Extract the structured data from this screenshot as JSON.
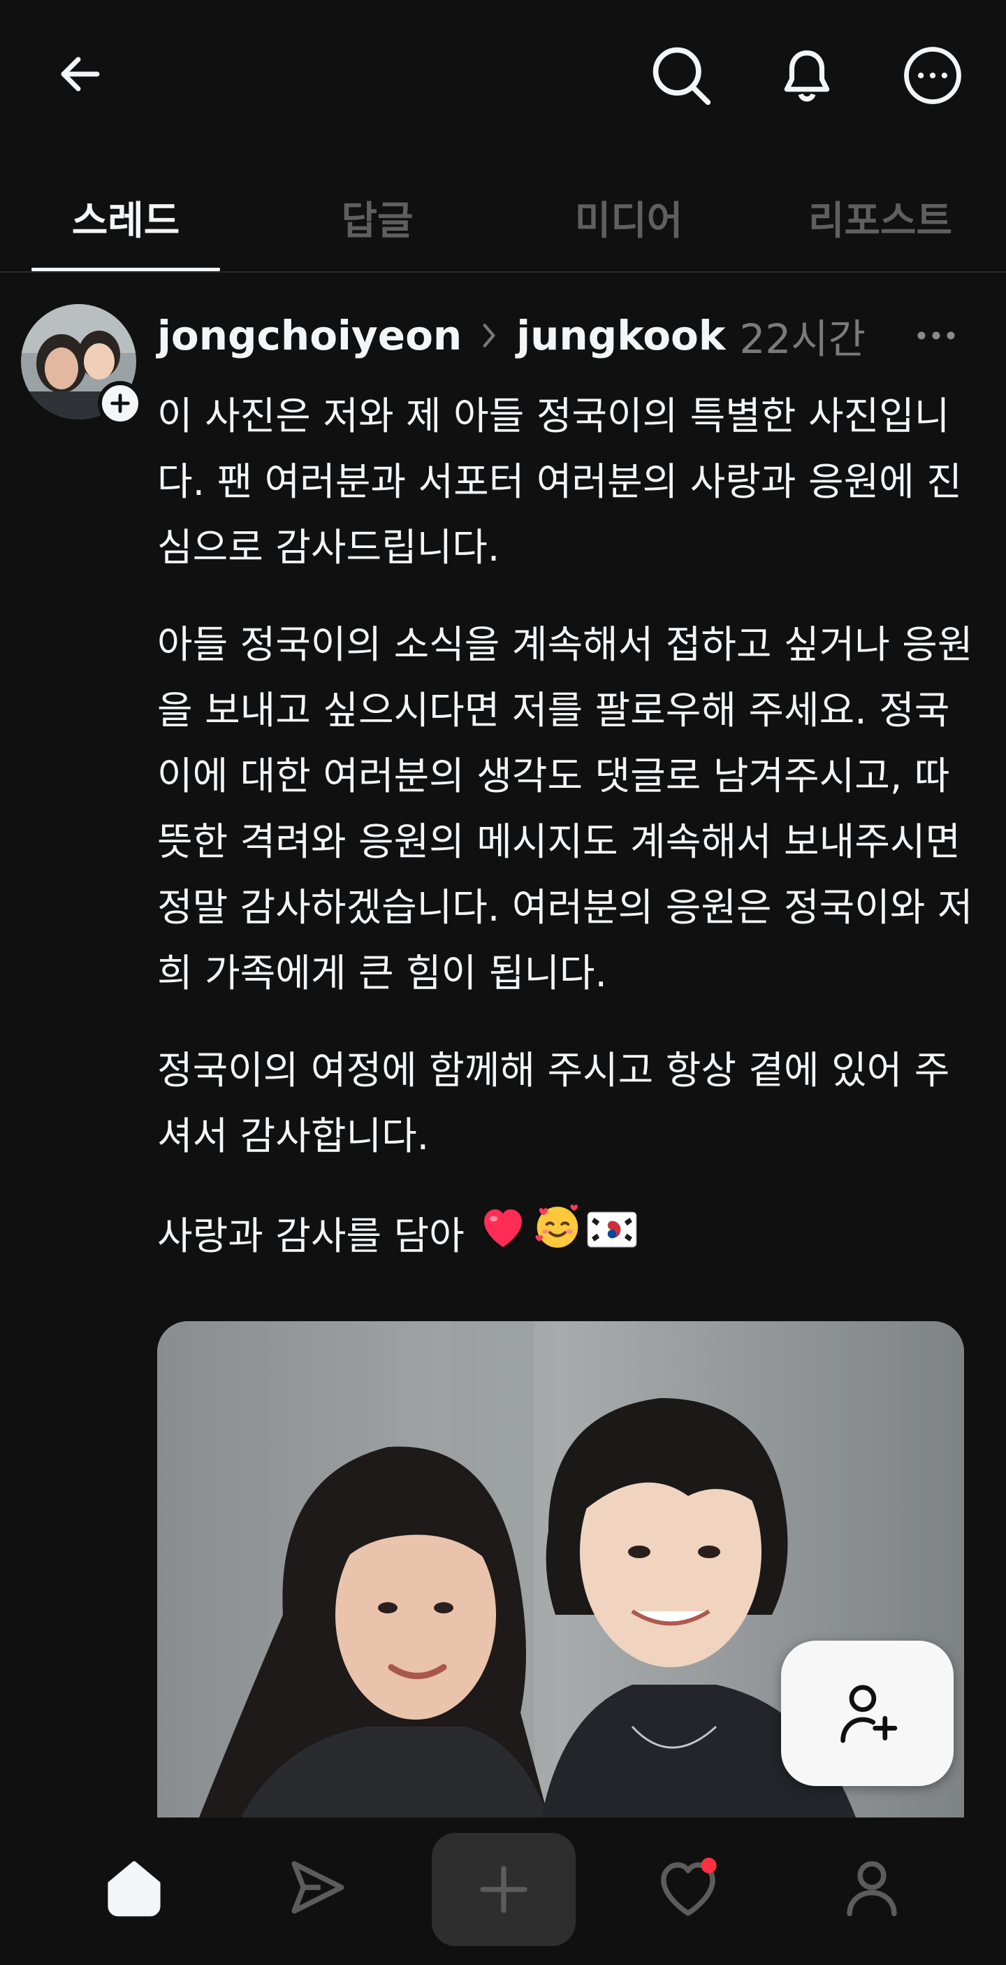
{
  "tabs": [
    {
      "label": "스레드"
    },
    {
      "label": "답글"
    },
    {
      "label": "미디어"
    },
    {
      "label": "리포스트"
    }
  ],
  "post": {
    "author": "jongchoiyeon",
    "reply_to": "jungkook",
    "time": "22시간",
    "paragraphs": [
      "이 사진은 저와 제 아들 정국이의 특별한 사진입니다. 팬 여러분과 서포터 여러분의 사랑과 응원에 진심으로 감사드립니다.",
      "아들 정국이의 소식을 계속해서 접하고 싶거나 응원을 보내고 싶으시다면 저를 팔로우해 주세요. 정국이에 대한 여러분의 생각도 댓글로 남겨주시고, 따뜻한 격려와 응원의 메시지도 계속해서 보내주시면 정말 감사하겠습니다. 여러분의 응원은 정국이와 저희 가족에게 큰 힘이 됩니다.",
      "정국이의 여정에 함께해 주시고 항상 곁에 있어 주셔서 감사합니다.",
      "사랑과 감사를 담아"
    ],
    "closing_emojis": [
      "red-heart",
      "smiling-face-with-hearts",
      "south-korea-flag"
    ]
  },
  "colors": {
    "background": "#101010",
    "text_primary": "#f3f5f7",
    "text_muted": "#7a7a7a",
    "notification_dot": "#ff3040",
    "heart": "#ff2d55"
  },
  "icons": {
    "back": "arrow-left-icon",
    "search": "search-icon",
    "notifications": "bell-icon",
    "more": "more-circle-icon",
    "home": "home-icon",
    "direct": "send-icon",
    "create": "plus-icon",
    "activity": "heart-icon",
    "profile": "person-icon",
    "follow": "person-add-icon"
  }
}
